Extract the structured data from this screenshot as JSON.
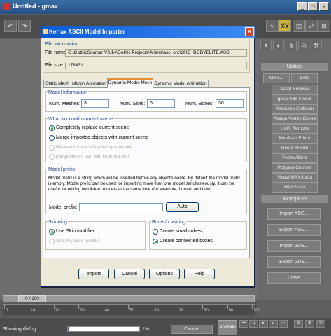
{
  "app": {
    "title": "Untitled - gmax",
    "window_buttons": [
      "_",
      "□",
      "×"
    ],
    "toolbar_label": "XY"
  },
  "utilities": {
    "header": "Utilities",
    "more_label": "More...",
    "sets_label": "Sets",
    "items": [
      "Asset Browser",
      "gmax File Finder",
      "Resource Collector",
      "Assign Vertex Colors",
      "UVW Remove",
      "MapPath Editor",
      "Reset XForm",
      "Follow/Bank",
      "Polygon Counter",
      "Visual MAXScript",
      "MAXScript"
    ]
  },
  "kex": {
    "header": "KxstripExp",
    "buttons": [
      "Import ASC...",
      "Export ASC...",
      "Import 3DS...",
      "Export 3DS...",
      "Close"
    ]
  },
  "timeline": {
    "slider_label": "0 / 100",
    "ticks": [
      "0",
      "10",
      "20",
      "30",
      "40",
      "50",
      "60",
      "70",
      "80",
      "90",
      "100"
    ]
  },
  "statusbar": {
    "status_text": "Showing dialog",
    "progress_fraction": 0.01,
    "progress_label": "1%",
    "cancel_label": "Cancel",
    "animate_label": "Animate"
  },
  "dialog": {
    "title": "Kerrax ASCII Model Importer",
    "close_glyph": "×",
    "file_info": {
      "group_label": "File Information",
      "file_name_label": "File name:",
      "file_name_value": "G:\\GothicSourcer V3.14\\Gothic Projects\\Anims\\asc_orc\\ORC_BODYELITE.ASC",
      "file_size_label": "File size:",
      "file_size_value": "178431"
    },
    "tabs": [
      "Static Mesh",
      "Morph Animation",
      "Dynamic Model Mesh",
      "Dynamic Model Animation"
    ],
    "model_info": {
      "group_label": "Model Information",
      "meshes_label": "Num. Meshes:",
      "meshes_value": "3",
      "slots_label": "Num. Slots:",
      "slots_value": "5",
      "bones_label": "Num. Bones:",
      "bones_value": "30"
    },
    "scene": {
      "group_label": "What to do with current scene",
      "options": [
        {
          "label": "Completely replace current scene",
          "selected": true,
          "enabled": true
        },
        {
          "label": "Merge imported objects with current scene",
          "selected": false,
          "enabled": true
        },
        {
          "label": "Replace current skin with imported skin",
          "selected": false,
          "enabled": false
        },
        {
          "label": "Merge current skin with imported skin",
          "selected": false,
          "enabled": false
        }
      ]
    },
    "prefix": {
      "group_label": "Model prefix",
      "description": "Model prefix is a string which will be inserted before any object's name. By default the model prefix is empty. Model prefix can be used for importing more than one model simultaneously. It can be useful for editing two linked models at the same time (for example, human and bow).",
      "field_label": "Model prefix:",
      "value": "",
      "auto_label": "Auto"
    },
    "skinning": {
      "group_label": "Skinning",
      "options": [
        {
          "label": "Use Skin modifier",
          "selected": true,
          "enabled": true
        },
        {
          "label": "Use Physique modifier",
          "selected": false,
          "enabled": false
        }
      ]
    },
    "bones": {
      "group_label": "Bones' creating",
      "options": [
        {
          "label": "Create small cubes",
          "selected": false,
          "enabled": true
        },
        {
          "label": "Create connected boxes",
          "selected": true,
          "enabled": true
        }
      ]
    },
    "buttons": [
      "Import",
      "Cancel",
      "Options",
      "Help"
    ]
  }
}
